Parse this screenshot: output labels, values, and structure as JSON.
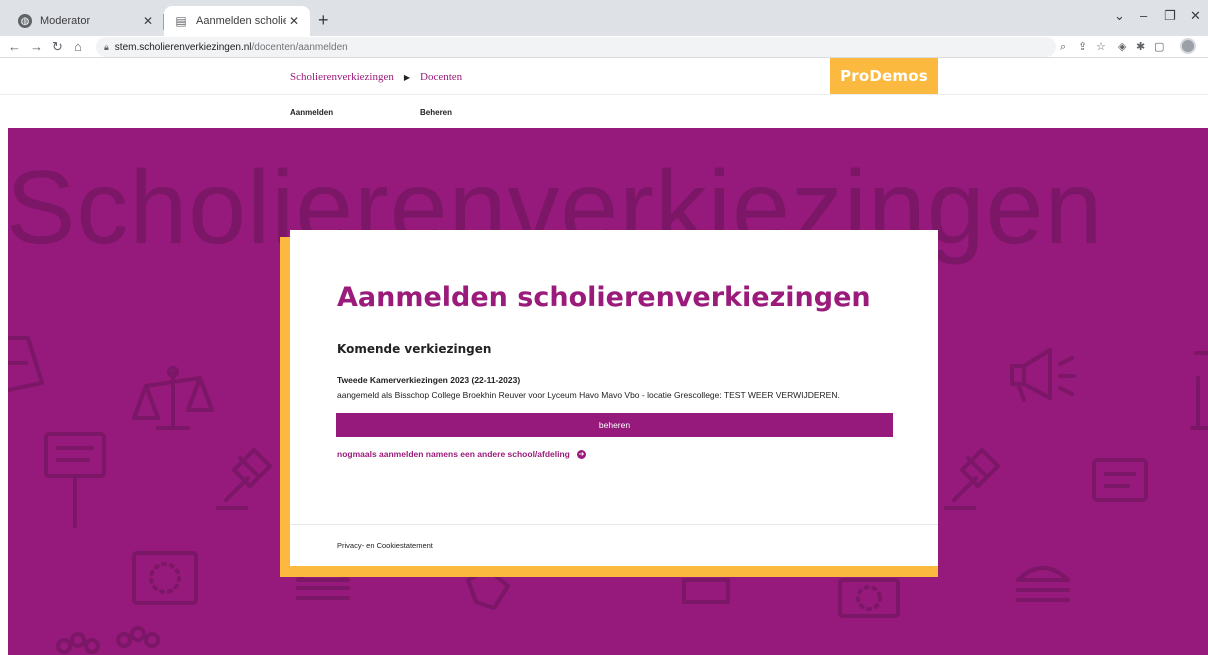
{
  "browser": {
    "tabs": [
      {
        "title": "Moderator",
        "active": false
      },
      {
        "title": "Aanmelden scholierenverkiezing",
        "active": true
      }
    ],
    "url_host": "stem.scholierenverkiezingen.nl",
    "url_path": "/docenten/aanmelden"
  },
  "header": {
    "breadcrumb": [
      "Scholierenverkiezingen",
      "Docenten"
    ],
    "brand": "ProDemos",
    "subnav": [
      "Aanmelden",
      "Beheren"
    ]
  },
  "hero": {
    "background_word": "Scholierenverkiezingen"
  },
  "card": {
    "title": "Aanmelden scholierenverkiezingen",
    "subtitle": "Komende verkiezingen",
    "election_name": "Tweede Kamerverkiezingen 2023 (22-11-2023)",
    "registration_text": "aangemeld als Bisschop College Broekhin Reuver voor Lyceum Havo Mavo Vbo - locatie Grescollege: TEST WEER VERWIJDEREN.",
    "manage_button": "beheren",
    "register_again": "nogmaals aanmelden namens een andere school/afdeling",
    "privacy_link": "Privacy- en Cookiestatement"
  },
  "colors": {
    "brand_purple": "#96197c",
    "brand_yellow": "#fbb93f",
    "link_purple": "#9b1b7b"
  }
}
